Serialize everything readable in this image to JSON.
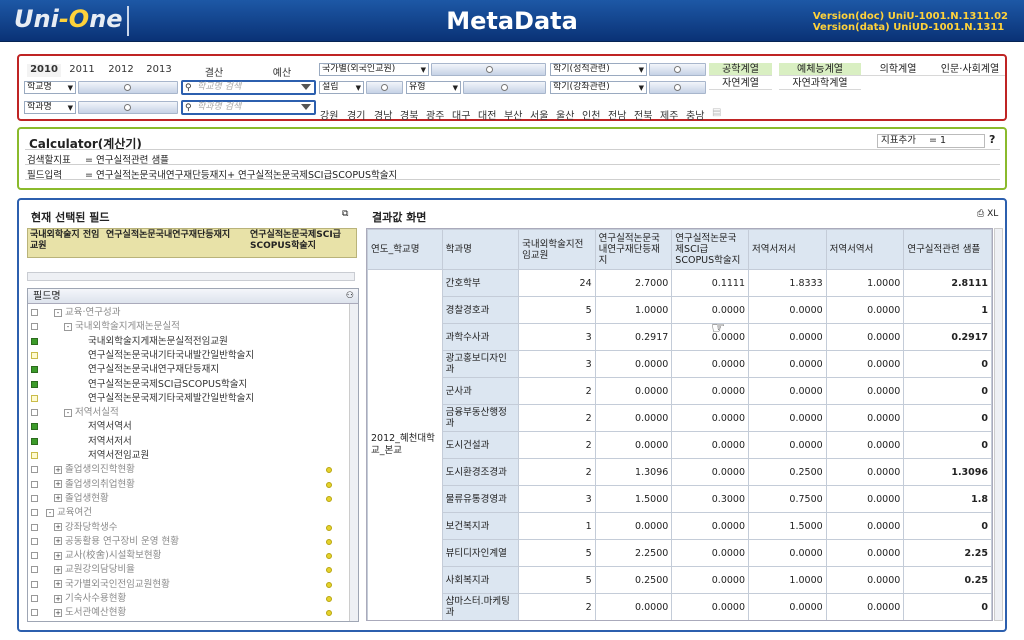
{
  "header": {
    "logo_left": "Uni",
    "logo_o": "-O",
    "logo_right": "ne",
    "title": "MetaData",
    "version_doc": "Version(doc)  UniU-1001.N.1311.02",
    "version_data": "Version(data) UniUD-1001.N.1311"
  },
  "filters": {
    "years": [
      "2010",
      "2011",
      "2012",
      "2013"
    ],
    "settle": "결산",
    "budget": "예산",
    "dd_country": "국가별(외국인교원)",
    "dd_semester1": "학기(성적관련)",
    "dd_school": "학교명",
    "dd_found": "설립",
    "dd_type": "유형",
    "dd_semester2": "학기(강좌관련)",
    "dd_dept": "학과명",
    "search_school_placeholder": "학교명 검색",
    "search_dept_placeholder": "학과명 검색",
    "regions": [
      "강원",
      "경기",
      "경남",
      "경북",
      "광주",
      "대구",
      "대전",
      "부산",
      "서울",
      "울산",
      "인천",
      "전남",
      "전북",
      "제주",
      "충남"
    ],
    "categories": [
      "공학계열",
      "예체능계열",
      "의학계열",
      "인문·사회계열",
      "자연계열",
      "자연과학계열"
    ]
  },
  "calculator": {
    "title": "Calculator(계산기)",
    "search_label": "검색할지표",
    "search_value": "= 연구실적관련 샘플",
    "field_label": "필드입력",
    "field_value": "= 연구실적논문국내연구재단등재지+  연구실적논문국제SCI급SCOPUS학술지",
    "index_add": "지표추가",
    "index_value": "= 1",
    "help": "?"
  },
  "selected": {
    "title": "현재 선택된 필드",
    "cols": [
      "국내외학술지 전임교원",
      "연구실적논문국내연구재단등재지",
      "연구실적논문국제SCI급SCOPUS학술지"
    ]
  },
  "tree": {
    "header": "필드명",
    "items": [
      {
        "t": "교육·연구성과",
        "lvl": 1,
        "exp": "-",
        "gray": true,
        "chk": ""
      },
      {
        "t": "국내외학술지게재논문실적",
        "lvl": 2,
        "exp": "-",
        "gray": true,
        "chk": ""
      },
      {
        "t": "국내외학술지게재논문실적전임교원",
        "lvl": 3,
        "gray": false,
        "chk": "on"
      },
      {
        "t": "연구실적논문국내기타국내발간일반학술지",
        "lvl": 3,
        "gray": false,
        "chk": "y"
      },
      {
        "t": "연구실적논문국내연구재단등재지",
        "lvl": 3,
        "gray": false,
        "chk": "on"
      },
      {
        "t": "연구실적논문국제SCI급SCOPUS학술지",
        "lvl": 3,
        "gray": false,
        "chk": "on"
      },
      {
        "t": "연구실적논문국제기타국제발간일반학술지",
        "lvl": 3,
        "gray": false,
        "chk": "y"
      },
      {
        "t": "저역서실적",
        "lvl": 2,
        "exp": "-",
        "gray": true,
        "chk": ""
      },
      {
        "t": "저역서역서",
        "lvl": 3,
        "gray": false,
        "chk": "on"
      },
      {
        "t": "저역서저서",
        "lvl": 3,
        "gray": false,
        "chk": "on"
      },
      {
        "t": "저역서전임교원",
        "lvl": 3,
        "gray": false,
        "chk": "y"
      },
      {
        "t": "졸업생의진학현황",
        "lvl": 1,
        "exp": "+",
        "gray": true,
        "chk": "",
        "dot": true
      },
      {
        "t": "졸업생의취업현황",
        "lvl": 1,
        "exp": "+",
        "gray": true,
        "chk": "",
        "dot": true
      },
      {
        "t": "졸업생현황",
        "lvl": 1,
        "exp": "+",
        "gray": true,
        "chk": "",
        "dot": true
      },
      {
        "t": "교육여건",
        "lvl": 0,
        "exp": "-",
        "gray": true,
        "chk": ""
      },
      {
        "t": "강좌당학생수",
        "lvl": 1,
        "exp": "+",
        "gray": true,
        "chk": "",
        "dot": true
      },
      {
        "t": "공동활용 연구장비 운영 현황",
        "lvl": 1,
        "exp": "+",
        "gray": true,
        "chk": "",
        "dot": true
      },
      {
        "t": "교사(校舍)시설확보현황",
        "lvl": 1,
        "exp": "+",
        "gray": true,
        "chk": "",
        "dot": true
      },
      {
        "t": "교원강의담당비율",
        "lvl": 1,
        "exp": "+",
        "gray": true,
        "chk": "",
        "dot": true
      },
      {
        "t": "국가별외국인전임교원현황",
        "lvl": 1,
        "exp": "+",
        "gray": true,
        "chk": "",
        "dot": true
      },
      {
        "t": "기숙사수용현황",
        "lvl": 1,
        "exp": "+",
        "gray": true,
        "chk": "",
        "dot": true
      },
      {
        "t": "도서관예산현황",
        "lvl": 1,
        "exp": "+",
        "gray": true,
        "chk": "",
        "dot": true
      }
    ]
  },
  "results": {
    "title": "결과값 화면",
    "xl": "XL",
    "headers": [
      "연도_학교명",
      "학과명",
      "국내외학술지전임교원",
      "연구실적논문국내연구재단등재지",
      "연구실적논문국제SCI급SCOPUS학술지",
      "저역서저서",
      "저역서역서",
      "연구실적관련 샘플"
    ],
    "school": "2012_혜천대학교_본교",
    "rows": [
      [
        "간호학부",
        "24",
        "2.7000",
        "0.1111",
        "1.8333",
        "1.0000",
        "2.8111"
      ],
      [
        "경찰경호과",
        "5",
        "1.0000",
        "0.0000",
        "0.0000",
        "0.0000",
        "1"
      ],
      [
        "과학수사과",
        "3",
        "0.2917",
        "0.0000",
        "0.0000",
        "0.0000",
        "0.2917"
      ],
      [
        "광고홍보디자인과",
        "3",
        "0.0000",
        "0.0000",
        "0.0000",
        "0.0000",
        "0"
      ],
      [
        "군사과",
        "2",
        "0.0000",
        "0.0000",
        "0.0000",
        "0.0000",
        "0"
      ],
      [
        "금융부동산행정과",
        "2",
        "0.0000",
        "0.0000",
        "0.0000",
        "0.0000",
        "0"
      ],
      [
        "도시건설과",
        "2",
        "0.0000",
        "0.0000",
        "0.0000",
        "0.0000",
        "0"
      ],
      [
        "도시환경조경과",
        "2",
        "1.3096",
        "0.0000",
        "0.2500",
        "0.0000",
        "1.3096"
      ],
      [
        "물류유통경영과",
        "3",
        "1.5000",
        "0.3000",
        "0.7500",
        "0.0000",
        "1.8"
      ],
      [
        "보건복지과",
        "1",
        "0.0000",
        "0.0000",
        "1.5000",
        "0.0000",
        "0"
      ],
      [
        "뷰티디자인계열",
        "5",
        "2.2500",
        "0.0000",
        "0.0000",
        "0.0000",
        "2.25"
      ],
      [
        "사회복지과",
        "5",
        "0.2500",
        "0.0000",
        "1.0000",
        "0.0000",
        "0.25"
      ],
      [
        "샵마스터.마케팅과",
        "2",
        "0.0000",
        "0.0000",
        "0.0000",
        "0.0000",
        "0"
      ]
    ]
  }
}
